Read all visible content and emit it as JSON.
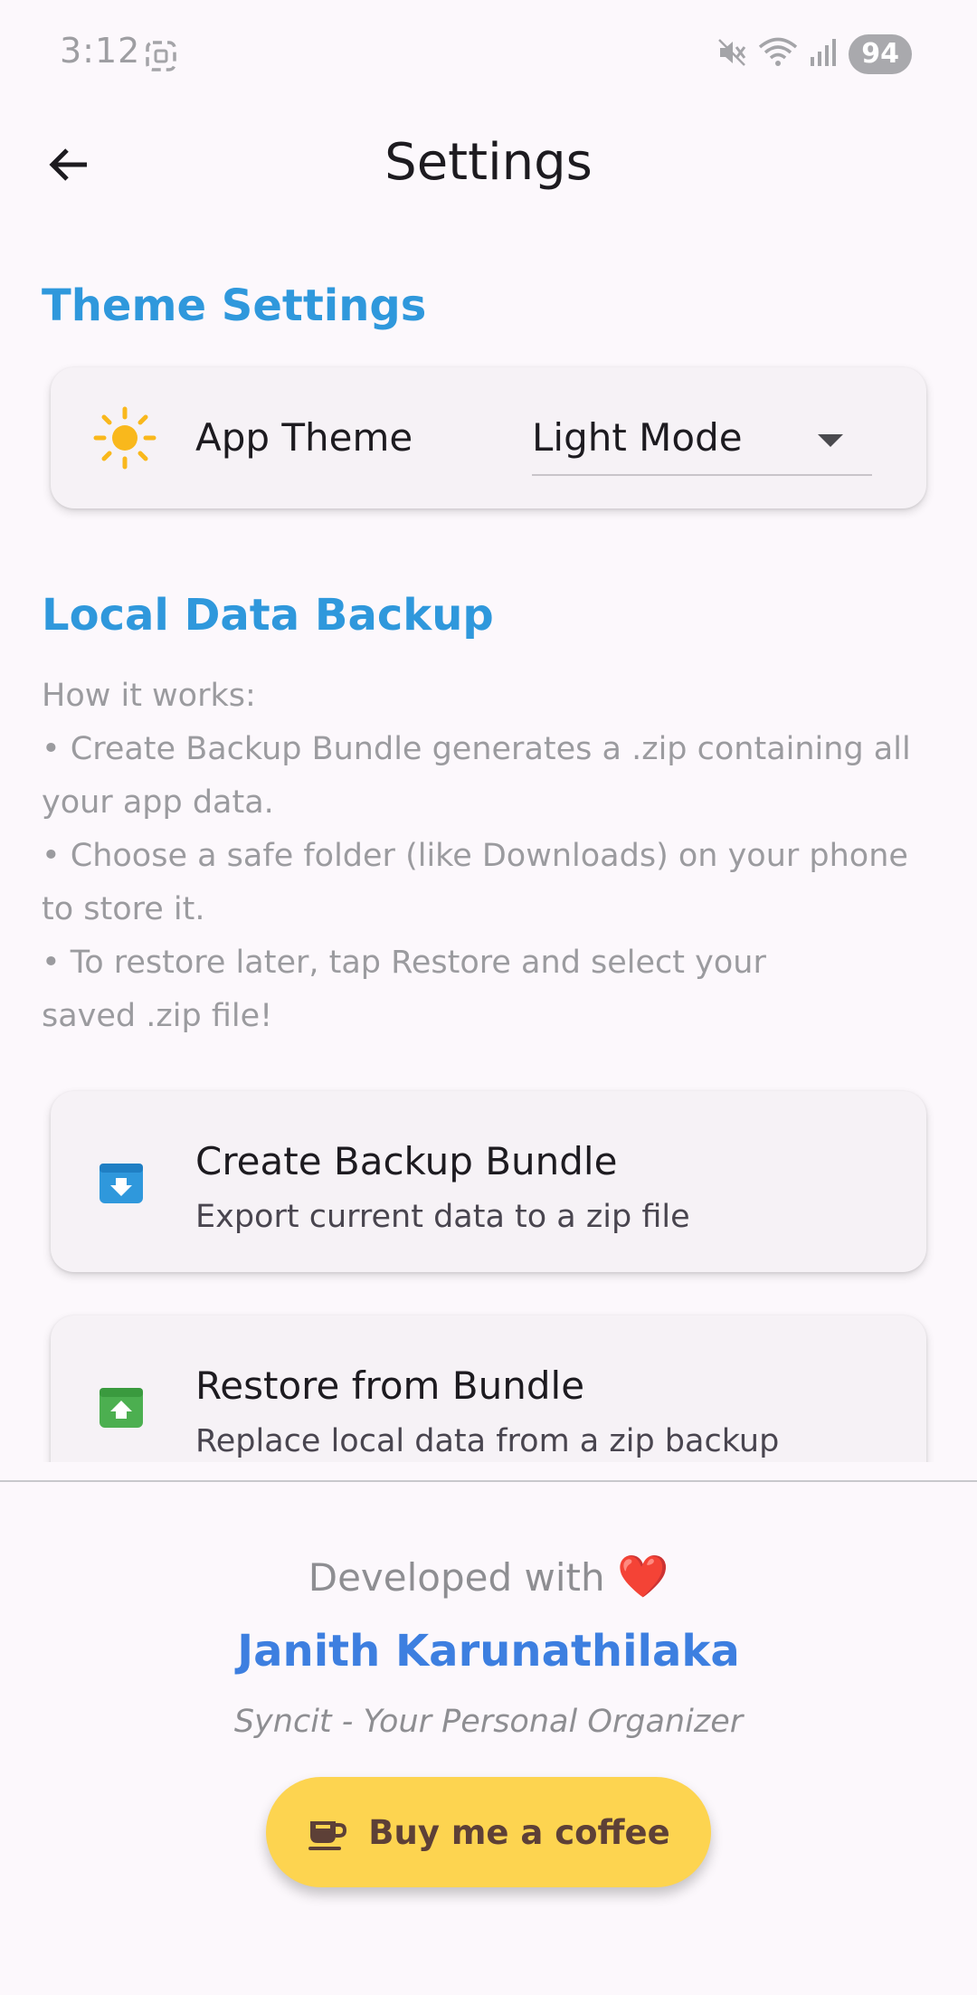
{
  "status_bar": {
    "time": "3:12",
    "battery": "94"
  },
  "app_bar": {
    "title": "Settings"
  },
  "theme_section": {
    "title": "Theme Settings",
    "app_theme_label": "App Theme",
    "selected_theme": "Light Mode"
  },
  "backup_section": {
    "title": "Local Data Backup",
    "info_lines": [
      "How it works:",
      "• Create Backup Bundle generates a .zip containing all",
      "your app data.",
      "• Choose a safe folder (like Downloads) on your phone",
      "to store it.",
      "• To restore later, tap Restore and select your",
      "saved .zip file!"
    ],
    "create": {
      "title": "Create Backup Bundle",
      "subtitle": "Export current data to a zip file"
    },
    "restore": {
      "title": "Restore from Bundle",
      "subtitle": "Replace local data from a zip backup"
    }
  },
  "footer": {
    "developed_with": "Developed with",
    "heart": "❤️",
    "author": "Janith Karunathilaka",
    "tagline": "Syncit - Your Personal Organizer",
    "coffee_label": "Buy me a coffee"
  },
  "colors": {
    "accent": "#2f98dc",
    "author": "#3d7fe0",
    "coffee_button": "#fdd450",
    "create_icon": "#2f98dc",
    "restore_icon": "#4caf50",
    "sun_icon": "#f9b81c"
  }
}
